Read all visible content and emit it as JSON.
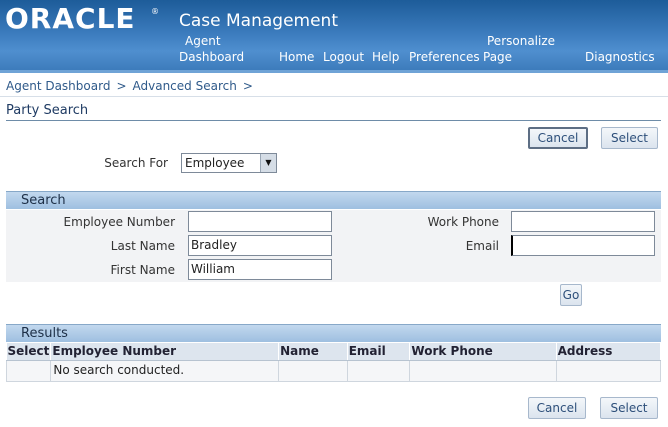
{
  "header": {
    "logo": "ORACLE",
    "logo_mark": "®",
    "app_title": "Case Management",
    "links": {
      "agent_dashboard_1": "Agent",
      "agent_dashboard_2": "Dashboard",
      "home": "Home",
      "logout": "Logout",
      "help": "Help",
      "preferences": "Preferences",
      "personalize_1": "Personalize",
      "personalize_2": "Page",
      "diagnostics": "Diagnostics"
    }
  },
  "breadcrumb": {
    "items": [
      "Agent Dashboard",
      "Advanced Search"
    ],
    "separator": ">"
  },
  "page": {
    "title": "Party Search",
    "cancel_label": "Cancel",
    "select_label": "Select"
  },
  "search_for": {
    "label": "Search For",
    "value": "Employee"
  },
  "search": {
    "section_title": "Search",
    "employee_number_label": "Employee Number",
    "employee_number_value": "",
    "last_name_label": "Last Name",
    "last_name_value": "Bradley",
    "first_name_label": "First Name",
    "first_name_value": "William",
    "work_phone_label": "Work Phone",
    "work_phone_value": "",
    "email_label": "Email",
    "email_value": "",
    "go_label": "Go"
  },
  "results": {
    "section_title": "Results",
    "columns": [
      "Select",
      "Employee Number",
      "Name",
      "Email",
      "Work Phone",
      "Address"
    ],
    "empty_message": "No search conducted."
  },
  "colors": {
    "header_blue": "#3b7bbd",
    "section_header": "#aecbe8",
    "link_text": "#2f5a8a"
  }
}
